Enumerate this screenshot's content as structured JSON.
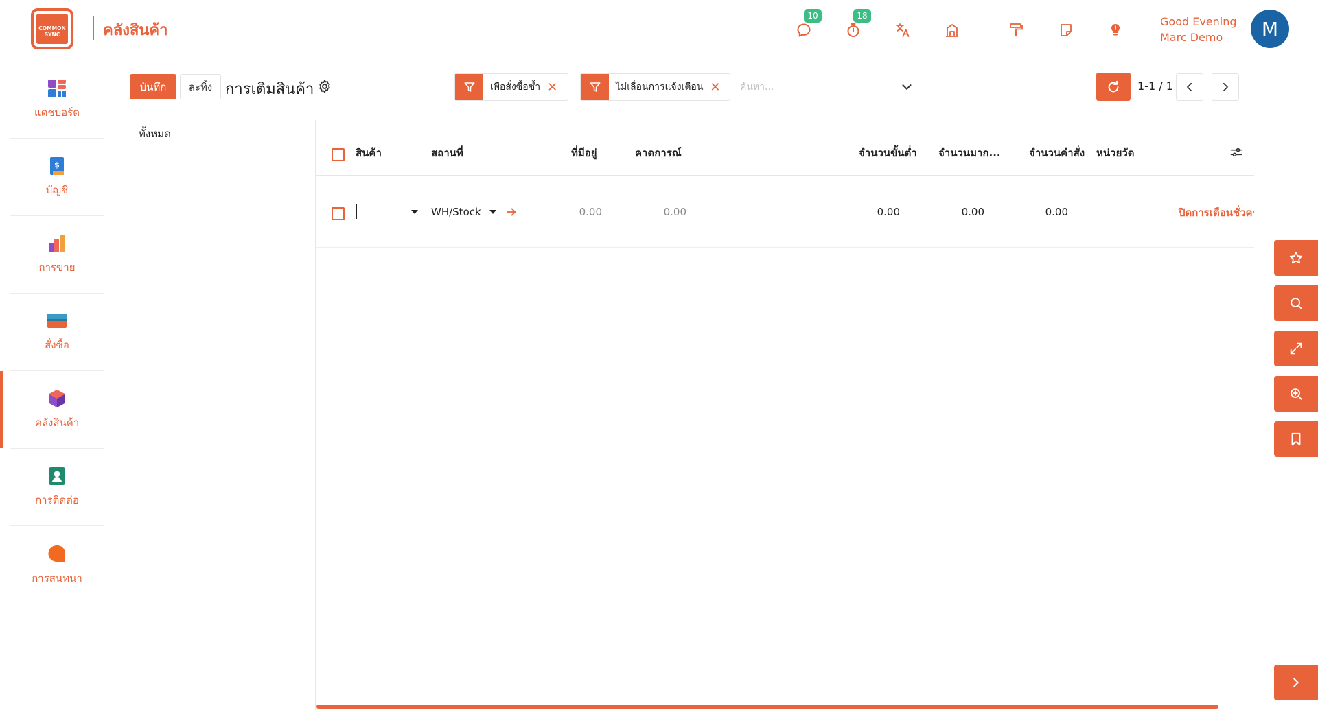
{
  "header": {
    "logo_text": "COMMON SYNC",
    "app_title": "คลังสินค้า",
    "messages_badge": "10",
    "activities_badge": "18",
    "greeting": "Good Evening",
    "user_name": "Marc Demo",
    "avatar_letter": "M"
  },
  "sidebar": {
    "items": [
      {
        "label": "แดชบอร์ด"
      },
      {
        "label": "บัญชี"
      },
      {
        "label": "การขาย"
      },
      {
        "label": "สั่งซื้อ"
      },
      {
        "label": "คลังสินค้า"
      },
      {
        "label": "การติดต่อ"
      },
      {
        "label": "การสนทนา"
      }
    ]
  },
  "control": {
    "save_label": "บันทึก",
    "discard_label": "ละทิ้ง",
    "page_title": "การเติมสินค้า",
    "facets": [
      {
        "label": "เพื่อสั่งซื้อซ้ำ"
      },
      {
        "label": "ไม่เลื่อนการแจ้งเตือน"
      }
    ],
    "search_placeholder": "ค้นหา...",
    "pager_value": "1-1 / 1"
  },
  "search_panel": {
    "all_label": "ทั้งหมด"
  },
  "table": {
    "columns": [
      "สินค้า",
      "สถานที่",
      "ที่มีอยู่",
      "คาดการณ์",
      "จำนวนขั้นต่ำ",
      "จำนวนมาก...",
      "จำนวนคำสั่ง",
      "หน่วยวัด"
    ],
    "rows": [
      {
        "product": "",
        "location": "WH/Stock",
        "on_hand": "0.00",
        "forecast": "0.00",
        "min_qty": "0.00",
        "max_qty": "0.00",
        "order_qty": "0.00",
        "uom": "",
        "snooze_label": "ปิดการเตือนชั่วคราว"
      }
    ]
  },
  "colors": {
    "accent": "#e8623a",
    "badge": "#3ebc86",
    "avatar": "#1a64a6"
  },
  "icons": {
    "header": [
      "chat-icon",
      "stopwatch-icon",
      "translate-icon",
      "building-icon",
      "paint-roller-icon",
      "note-icon",
      "lightbulb-icon"
    ],
    "float": [
      "star-icon",
      "search-icon",
      "expand-icon",
      "zoom-in-icon",
      "bookmark-icon",
      "chevron-right-icon"
    ]
  }
}
